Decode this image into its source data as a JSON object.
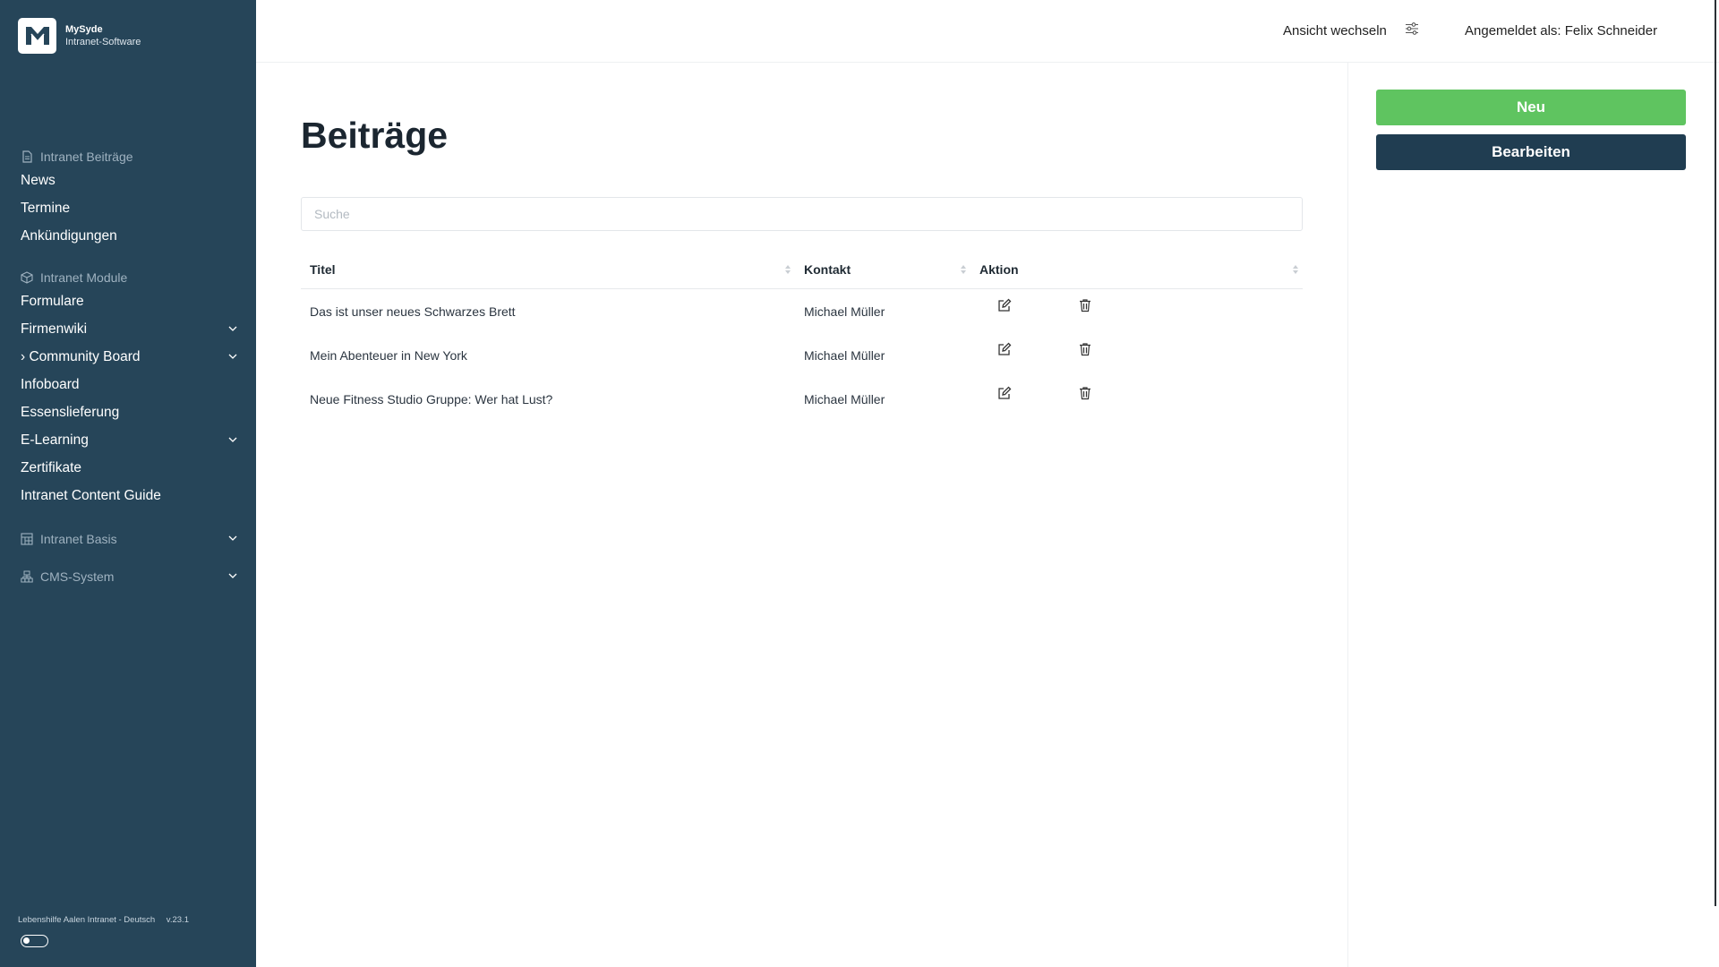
{
  "brand": {
    "name": "MySyde",
    "subtitle": "Intranet-Software"
  },
  "sidebar": {
    "sections": [
      {
        "label": "Intranet Beiträge",
        "icon": "document-icon",
        "items": [
          "News",
          "Termine",
          "Ankündigungen"
        ]
      },
      {
        "label": "Intranet Module",
        "icon": "cube-icon",
        "items": [
          "Formulare",
          "Firmenwiki",
          "› Community Board",
          "Infoboard",
          "Essenslieferung",
          "E-Learning",
          "Zertifikate",
          "Intranet Content Guide"
        ]
      },
      {
        "label": "Intranet Basis",
        "icon": "grid-icon"
      },
      {
        "label": "CMS-System",
        "icon": "sitemap-icon"
      }
    ],
    "footer": {
      "instance": "Lebenshilfe Aalen Intranet - Deutsch",
      "version": "v.23.1"
    }
  },
  "header": {
    "view_switch_label": "Ansicht wechseln",
    "view_switch_icon": "sliders-icon",
    "logged_in": "Angemeldet als: Felix Schneider"
  },
  "main": {
    "title": "Beiträge",
    "search_placeholder": "Suche",
    "table": {
      "columns": [
        "Titel",
        "Kontakt",
        "Aktion"
      ],
      "rows": [
        {
          "title": "Das ist unser neues Schwarzes Brett",
          "contact": "Michael Müller"
        },
        {
          "title": "Mein Abenteuer in New York",
          "contact": "Michael Müller"
        },
        {
          "title": "Neue Fitness Studio Gruppe: Wer hat Lust?",
          "contact": "Michael Müller"
        }
      ]
    }
  },
  "actions": {
    "new_label": "Neu",
    "edit_label": "Bearbeiten"
  },
  "colors": {
    "sidebar_bg": "#264559",
    "new_button": "#5fc460",
    "edit_button": "#203d51"
  }
}
